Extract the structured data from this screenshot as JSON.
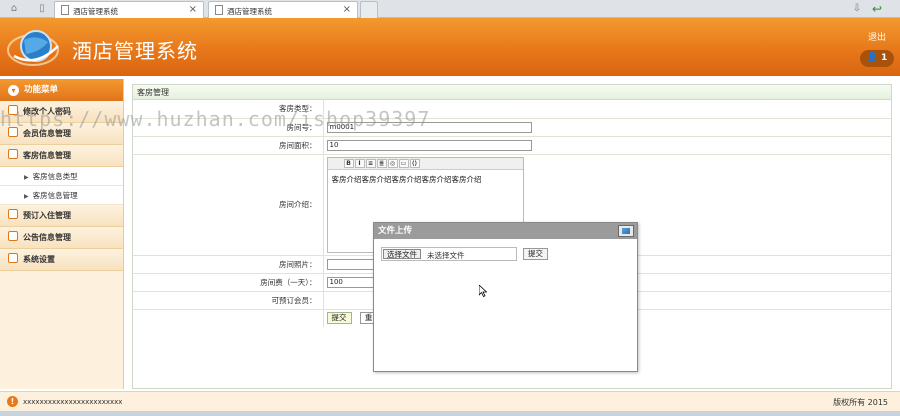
{
  "browser": {
    "tabs": [
      {
        "title": "酒店管理系统"
      },
      {
        "title": "酒店管理系统"
      }
    ]
  },
  "header": {
    "title": "酒店管理系统",
    "logout": "退出",
    "user_count": "1"
  },
  "sidebar": {
    "head": "功能菜单",
    "items": [
      {
        "label": "修改个人密码"
      },
      {
        "label": "会员信息管理"
      },
      {
        "label": "客房信息管理"
      },
      {
        "label": "预订入住管理"
      },
      {
        "label": "公告信息管理"
      },
      {
        "label": "系统设置"
      }
    ],
    "sub_items": [
      {
        "label": "客房信息类型"
      },
      {
        "label": "客房信息管理"
      }
    ]
  },
  "main": {
    "panel_title": "客房管理",
    "fields": {
      "room_type_label": "客房类型：",
      "room_no_label": "房间号：",
      "room_no_value": "m0001",
      "area_label": "房间面积：",
      "area_value": "10",
      "intro_label": "房间介绍：",
      "intro_value": "客房介绍客房介绍客房介绍客房介绍客房介绍",
      "photo_label": "房间照片：",
      "price_label": "房间费（一天）：",
      "price_value": "100",
      "member_label": "可预订会员："
    },
    "submit_label": "提交",
    "reset_label": "重"
  },
  "modal": {
    "title": "文件上传",
    "choose_file": "选择文件",
    "no_file": "未选择文件",
    "submit": "提交"
  },
  "watermark": "https://www.huzhan.com/ishop39397",
  "footer": {
    "left": "xxxxxxxxxxxxxxxxxxxxxxxx",
    "copyright": "版权所有 2015"
  },
  "colors": {
    "accent": "#e8781a",
    "sidebar_bg": "#fdf1de",
    "panel_border": "#cfd9c9"
  }
}
